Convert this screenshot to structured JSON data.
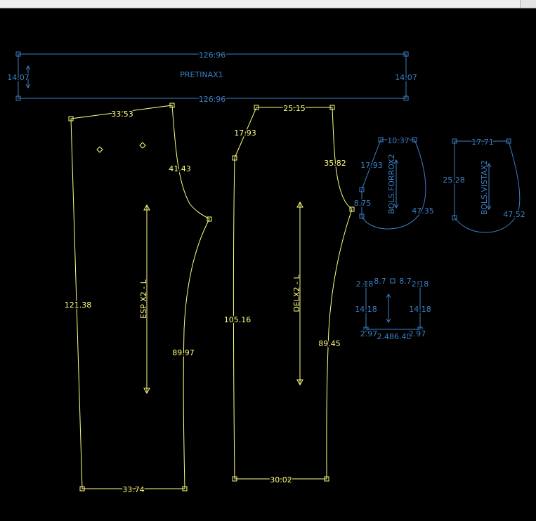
{
  "colors": {
    "background": "#000000",
    "front_back_pieces": "#ffff80",
    "small_pieces": "#3c7fc4"
  },
  "pieces": {
    "pretina": {
      "name": "PRETINAX1",
      "top_len": "126.96",
      "bottom_len": "126.96",
      "left_len": "14.07",
      "right_len": "14.07"
    },
    "espalda": {
      "name": "ESP X2 - L",
      "top": "33.53",
      "side": "41.43",
      "left": "121.38",
      "inseam": "89.97",
      "hem": "33.74"
    },
    "delantero": {
      "name": "DELX2 - L",
      "top": "25.15",
      "fly": "17.93",
      "curve": "35.82",
      "left": "105.16",
      "inseam": "89.45",
      "hem": "30.02"
    },
    "bolsillo_forro": {
      "name": "BOLS.FORROX2",
      "top": "10.37",
      "left": "17.93",
      "inner": "8.75",
      "curve": "47.35"
    },
    "bolsillo_vista": {
      "name": "BOLS.VISTAX2",
      "top": "17.71",
      "left": "25.28",
      "curve": "47.52"
    },
    "small": {
      "top_left": "2.18",
      "top_mid_a": "8.7",
      "top_mid_b": "8.7",
      "top_right": "2.18",
      "left": "14.18",
      "right": "14.18",
      "bottom_left": "2.97",
      "bottom_mid": "2.486.48",
      "bottom_right": "2.97"
    }
  }
}
